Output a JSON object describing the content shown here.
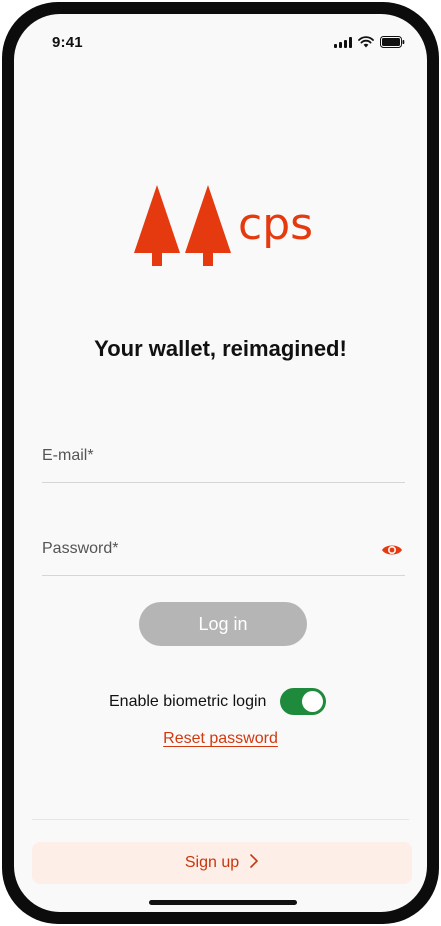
{
  "status_bar": {
    "time": "9:41"
  },
  "brand": {
    "logo_text": "cps",
    "color": "#e5390f"
  },
  "headline": "Your wallet, reimagined!",
  "form": {
    "email_label": "E-mail*",
    "password_label": "Password*",
    "login_label": "Log in"
  },
  "biometric": {
    "label": "Enable biometric login",
    "enabled": true
  },
  "reset_label": "Reset password",
  "signup_label": "Sign up",
  "icons": [
    "signal-icon",
    "wifi-icon",
    "battery-icon",
    "tree-logo-icon",
    "eye-icon",
    "chevron-right-icon"
  ],
  "colors": {
    "accent": "#e5390f",
    "toggle_on": "#1e8a3c",
    "disabled_button": "#b5b5b5",
    "signup_bg": "#fdeee7"
  }
}
